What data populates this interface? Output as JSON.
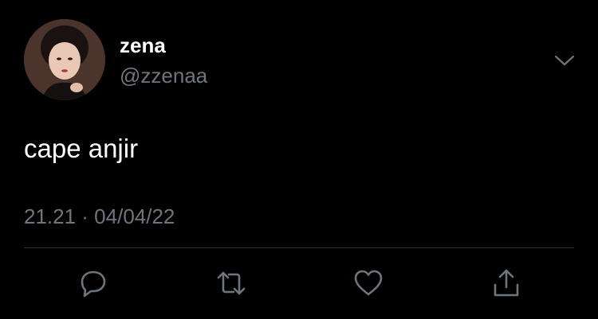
{
  "tweet": {
    "author": {
      "display_name": "zena",
      "handle": "@zzenaa",
      "avatar": "avatar-photo"
    },
    "text": "cape anjir",
    "timestamp": "21.21 · 04/04/22",
    "more_icon": "chevron-down-icon"
  },
  "actions": [
    {
      "name": "reply",
      "icon": "reply-icon"
    },
    {
      "name": "retweet",
      "icon": "retweet-icon"
    },
    {
      "name": "like",
      "icon": "heart-icon"
    },
    {
      "name": "share",
      "icon": "share-icon"
    }
  ],
  "colors": {
    "background": "#000000",
    "primary_text": "#ffffff",
    "secondary_text": "#6e767d",
    "icon": "#6e767d",
    "divider": "#2f3336"
  }
}
